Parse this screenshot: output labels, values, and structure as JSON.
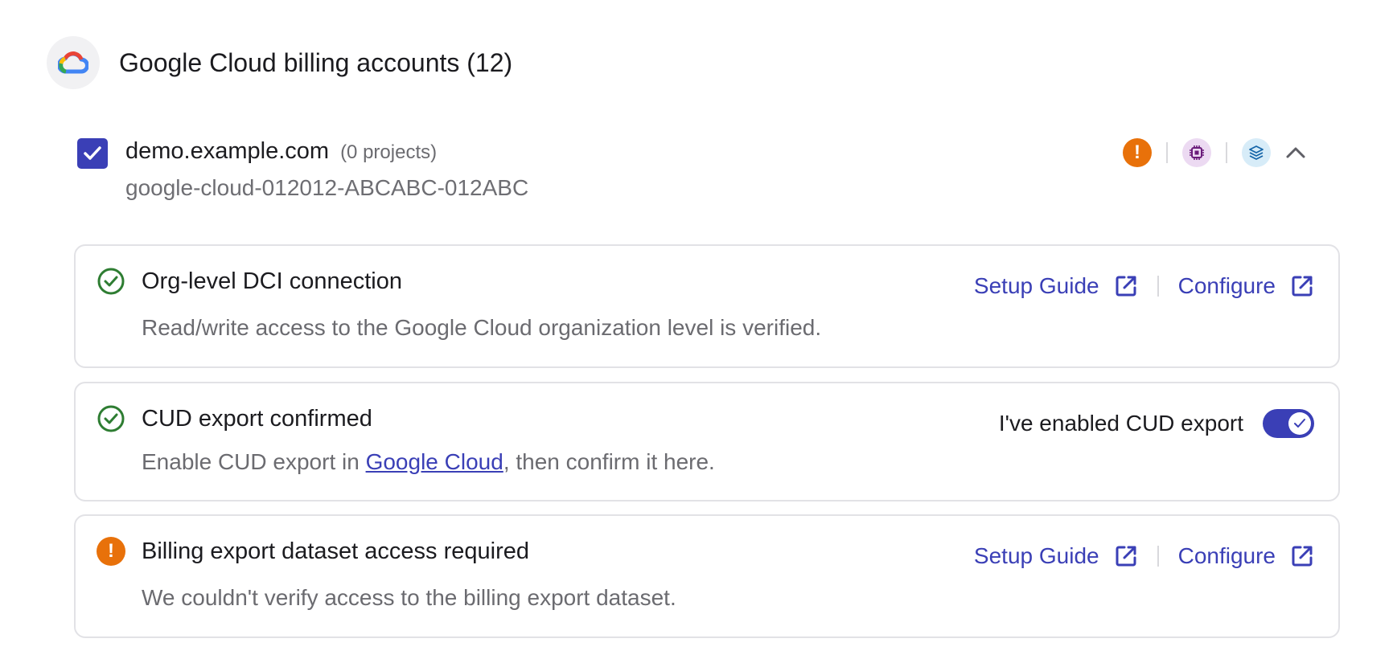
{
  "header": {
    "logo_icon": "google-cloud-logo-icon",
    "title": "Google Cloud billing accounts (12)"
  },
  "account": {
    "checked": true,
    "name": "demo.example.com",
    "projects": "(0 projects)",
    "billing_id": "google-cloud-012012-ABCABC-012ABC",
    "status_icons": [
      "alert-icon",
      "chip-icon",
      "layers-icon"
    ],
    "expand_icon": "chevron-up-icon",
    "alert_glyph": "!"
  },
  "colors": {
    "accent": "#3a3fb6",
    "success": "#2e7d32",
    "warning": "#e8710a"
  },
  "cards": [
    {
      "status": "success",
      "title": "Org-level DCI connection",
      "description": "Read/write access to the Google Cloud organization level is verified.",
      "setup_guide_label": "Setup Guide",
      "configure_label": "Configure"
    },
    {
      "status": "success",
      "title": "CUD export confirmed",
      "description_prefix": "Enable CUD export in ",
      "description_link": "Google Cloud",
      "description_suffix": ", then confirm it here.",
      "toggle_label": "I've enabled CUD export",
      "toggle_on": true
    },
    {
      "status": "warning",
      "title": "Billing export dataset access required",
      "description": "We couldn't verify access to the billing export dataset.",
      "setup_guide_label": "Setup Guide",
      "configure_label": "Configure",
      "warning_glyph": "!"
    }
  ]
}
